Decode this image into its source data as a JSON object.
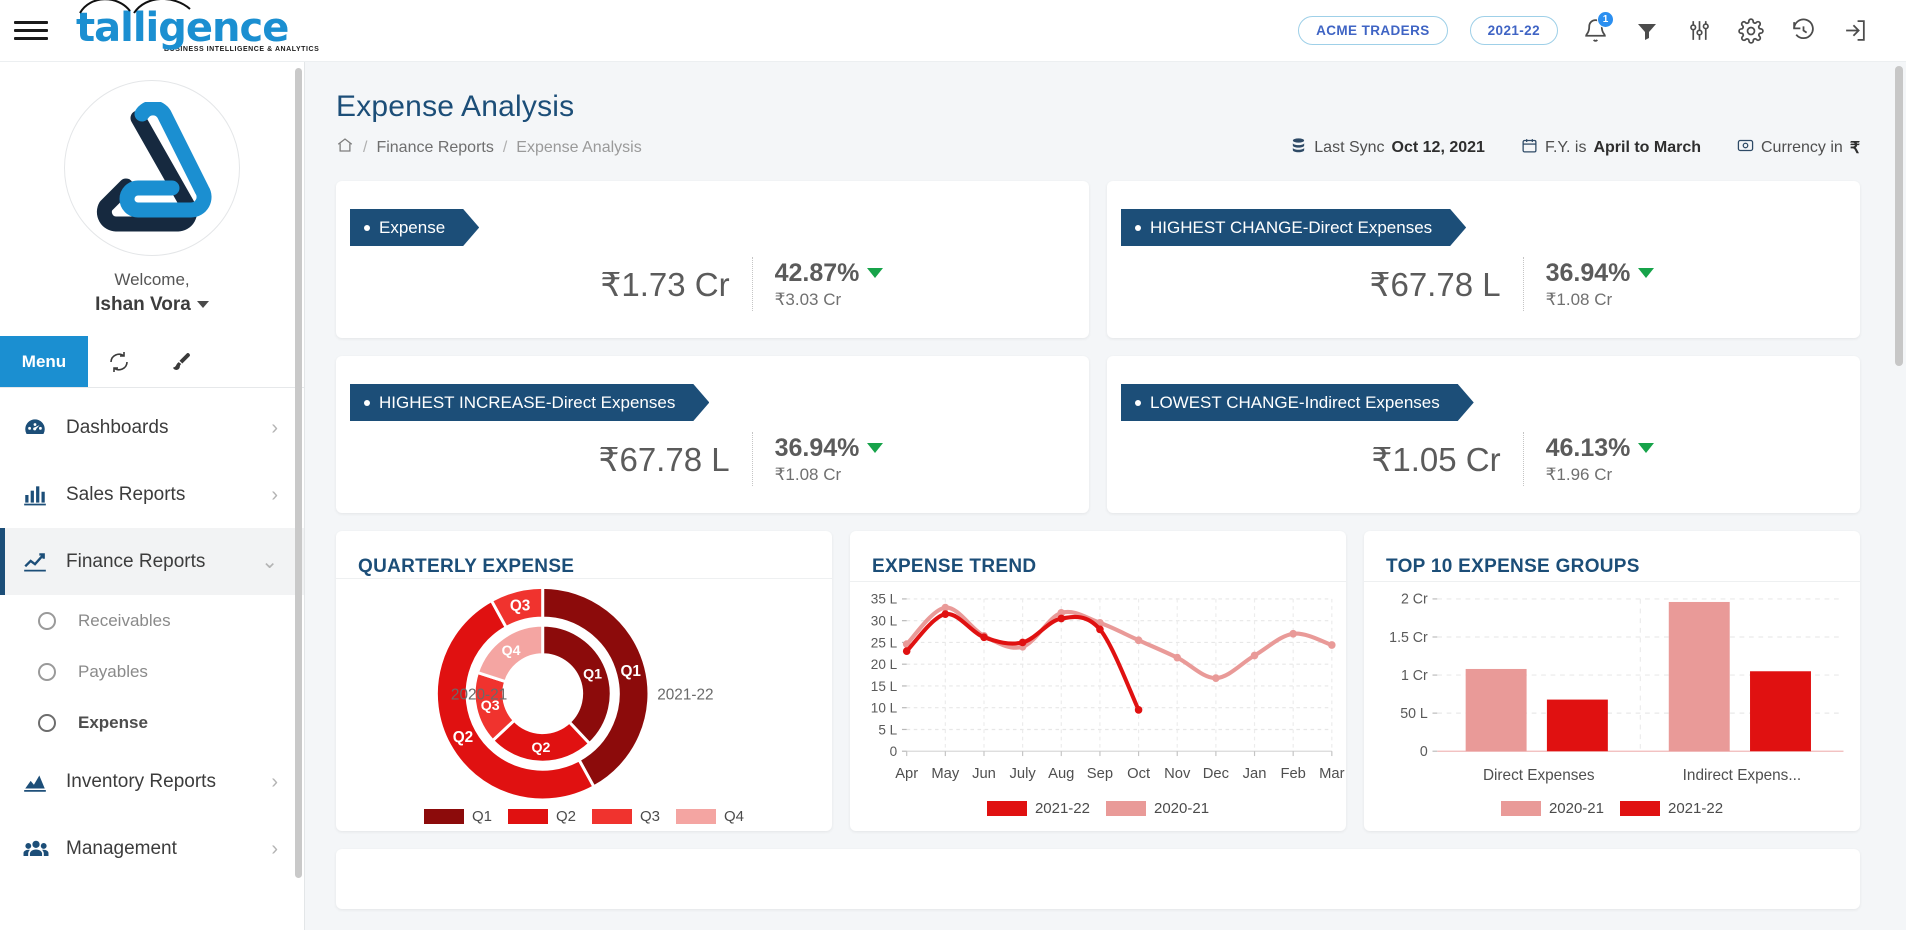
{
  "topbar": {
    "menu_icon": "hamburger-icon",
    "brand": "talligence",
    "brand_tagline": "BUSINESS INTELLIGENCE & ANALYTICS",
    "company_pill": "ACME TRADERS",
    "year_pill": "2021-22",
    "notification_count": "1",
    "icons": [
      "bell-icon",
      "filter-icon",
      "sliders-icon",
      "gear-icon",
      "history-icon",
      "logout-icon"
    ]
  },
  "sidebar": {
    "welcome_label": "Welcome,",
    "user_name": "Ishan Vora",
    "tabs": {
      "menu": "Menu",
      "refresh_icon": "refresh-icon",
      "theme_icon": "brush-icon"
    },
    "items": [
      {
        "label": "Dashboards",
        "icon": "speedometer-icon",
        "expandable": true
      },
      {
        "label": "Sales Reports",
        "icon": "bar-chart-icon",
        "expandable": true
      },
      {
        "label": "Finance Reports",
        "icon": "line-chart-icon",
        "expandable": true
      },
      {
        "label": "Inventory Reports",
        "icon": "area-chart-icon",
        "expandable": true
      },
      {
        "label": "Management",
        "icon": "people-icon",
        "expandable": true
      }
    ],
    "finance_subitems": [
      {
        "label": "Receivables",
        "selected": false
      },
      {
        "label": "Payables",
        "selected": false
      },
      {
        "label": "Expense",
        "selected": true
      }
    ]
  },
  "page": {
    "title": "Expense Analysis",
    "breadcrumb": {
      "home_icon": "home-icon",
      "parent": "Finance Reports",
      "current": "Expense Analysis"
    },
    "meta": {
      "last_sync_label": "Last Sync",
      "last_sync_value": "Oct 12, 2021",
      "fy_label": "F.Y. is",
      "fy_value": "April to March",
      "currency_label": "Currency in",
      "currency_value": "₹"
    }
  },
  "kpis": [
    {
      "title": "Expense",
      "value": "₹1.73 Cr",
      "percent": "42.87%",
      "sub": "₹3.03 Cr",
      "direction": "down"
    },
    {
      "title": "HIGHEST CHANGE-Direct Expenses",
      "value": "₹67.78 L",
      "percent": "36.94%",
      "sub": "₹1.08 Cr",
      "direction": "down"
    },
    {
      "title": "HIGHEST INCREASE-Direct Expenses",
      "value": "₹67.78 L",
      "percent": "36.94%",
      "sub": "₹1.08 Cr",
      "direction": "down"
    },
    {
      "title": "LOWEST CHANGE-Indirect Expenses",
      "value": "₹1.05 Cr",
      "percent": "46.13%",
      "sub": "₹1.96 Cr",
      "direction": "down"
    }
  ],
  "colors": {
    "q1": "#8c0b0b",
    "q2": "#e01111",
    "q3": "#f0332e",
    "q4": "#f4a5a2",
    "brand_blue": "#1b8fd1",
    "navy": "#1c4e78",
    "accent_green": "#17a34a"
  },
  "chart_data": [
    {
      "type": "pie",
      "title": "QUARTERLY EXPENSE",
      "legend": [
        "Q1",
        "Q2",
        "Q3",
        "Q4"
      ],
      "legend_position": "bottom",
      "rings": [
        {
          "name": "2021-22",
          "ring": "outer",
          "center_label": "2021-22",
          "categories": [
            "Q1",
            "Q2",
            "Q3"
          ],
          "values": [
            42,
            50,
            8
          ]
        },
        {
          "name": "2020-21",
          "ring": "inner",
          "center_label": "2020-21",
          "categories": [
            "Q1",
            "Q2",
            "Q3",
            "Q4"
          ],
          "values": [
            38,
            25,
            17,
            20
          ]
        }
      ]
    },
    {
      "type": "line",
      "title": "EXPENSE TREND",
      "x": [
        "Apr",
        "May",
        "Jun",
        "July",
        "Aug",
        "Sep",
        "Oct",
        "Nov",
        "Dec",
        "Jan",
        "Feb",
        "Mar"
      ],
      "ylabel": "",
      "xlabel": "",
      "ylim": [
        0,
        35
      ],
      "yticks": [
        0,
        5,
        10,
        15,
        20,
        25,
        30,
        35
      ],
      "ytick_labels": [
        "0",
        "5 L",
        "10 L",
        "15 L",
        "20 L",
        "25 L",
        "30 L",
        "35 L"
      ],
      "grid": true,
      "legend": [
        "2021-22",
        "2020-21"
      ],
      "legend_position": "bottom",
      "series": [
        {
          "name": "2021-22",
          "color": "#e01111",
          "values": [
            23.0,
            31.5,
            26.2,
            25.0,
            30.5,
            28.0,
            9.5,
            null,
            null,
            null,
            null,
            null
          ]
        },
        {
          "name": "2020-21",
          "color": "#e99a98",
          "values": [
            24.6,
            33.0,
            26.5,
            24.0,
            31.8,
            29.5,
            25.5,
            21.5,
            16.8,
            22.0,
            27.0,
            24.4
          ]
        }
      ]
    },
    {
      "type": "bar",
      "title": "TOP 10 EXPENSE GROUPS",
      "categories": [
        "Direct Expenses",
        "Indirect Expens..."
      ],
      "ylim": [
        0,
        2
      ],
      "yticks": [
        0,
        0.5,
        1,
        1.5,
        2
      ],
      "ytick_labels": [
        "0",
        "50 L",
        "1 Cr",
        "1.5 Cr",
        "2 Cr"
      ],
      "grid": true,
      "legend": [
        "2020-21",
        "2021-22"
      ],
      "legend_position": "bottom",
      "series": [
        {
          "name": "2020-21",
          "color": "#e99a98",
          "values": [
            1.08,
            1.96
          ]
        },
        {
          "name": "2021-22",
          "color": "#e01111",
          "values": [
            0.678,
            1.05
          ]
        }
      ]
    }
  ]
}
